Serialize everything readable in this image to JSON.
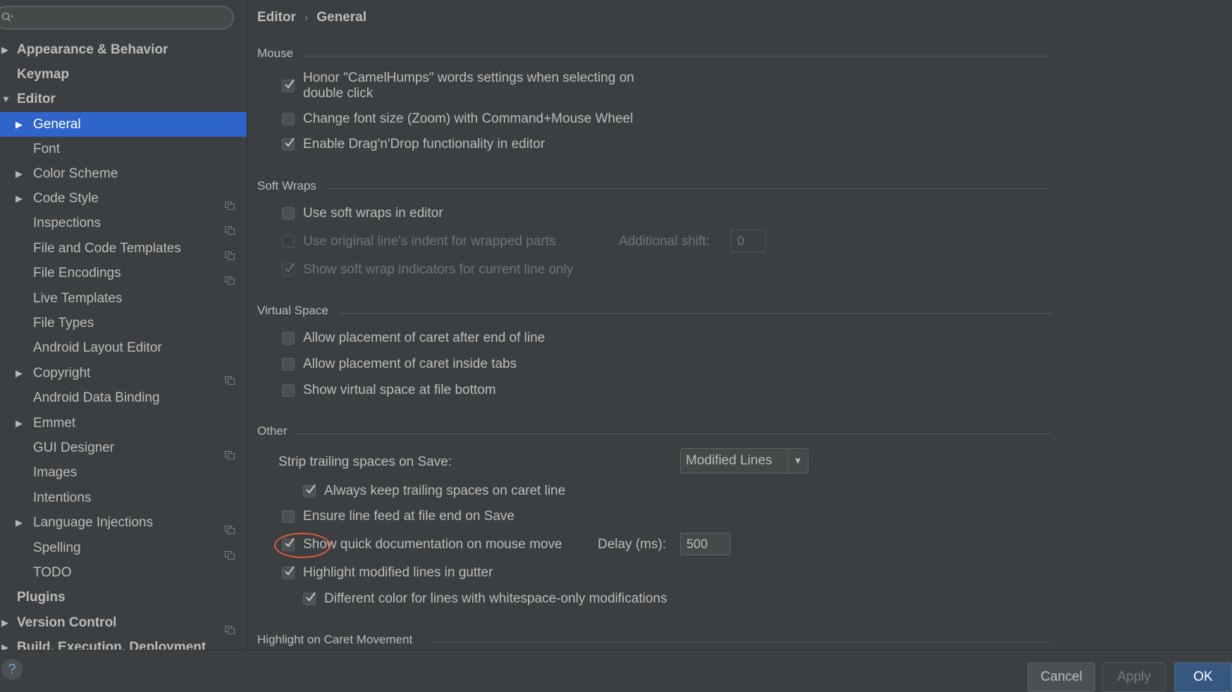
{
  "search": {
    "placeholder": ""
  },
  "sidebar": {
    "items": [
      {
        "label": "Appearance & Behavior"
      },
      {
        "label": "Keymap"
      },
      {
        "label": "Editor"
      },
      {
        "label": "General"
      },
      {
        "label": "Font"
      },
      {
        "label": "Color Scheme"
      },
      {
        "label": "Code Style"
      },
      {
        "label": "Inspections"
      },
      {
        "label": "File and Code Templates"
      },
      {
        "label": "File Encodings"
      },
      {
        "label": "Live Templates"
      },
      {
        "label": "File Types"
      },
      {
        "label": "Android Layout Editor"
      },
      {
        "label": "Copyright"
      },
      {
        "label": "Android Data Binding"
      },
      {
        "label": "Emmet"
      },
      {
        "label": "GUI Designer"
      },
      {
        "label": "Images"
      },
      {
        "label": "Intentions"
      },
      {
        "label": "Language Injections"
      },
      {
        "label": "Spelling"
      },
      {
        "label": "TODO"
      },
      {
        "label": "Plugins"
      },
      {
        "label": "Version Control"
      },
      {
        "label": "Build, Execution, Deployment"
      }
    ]
  },
  "breadcrumb": {
    "parent": "Editor",
    "separator": "›",
    "current": "General"
  },
  "sections": {
    "mouse": {
      "title": "Mouse",
      "camelhumps_line1": "Honor \"CamelHumps\" words settings when selecting on",
      "camelhumps_line2": "double click",
      "zoom": "Change font size (Zoom) with Command+Mouse Wheel",
      "dragdrop": "Enable Drag'n'Drop functionality in editor"
    },
    "soft_wraps": {
      "title": "Soft Wraps",
      "use_soft_wraps": "Use soft wraps in editor",
      "original_indent": "Use original line's indent for wrapped parts",
      "additional_shift_label": "Additional shift:",
      "additional_shift_value": "0",
      "indicators": "Show soft wrap indicators for current line only"
    },
    "virtual_space": {
      "title": "Virtual Space",
      "after_eol": "Allow placement of caret after end of line",
      "inside_tabs": "Allow placement of caret inside tabs",
      "file_bottom": "Show virtual space at file bottom"
    },
    "other": {
      "title": "Other",
      "strip_label": "Strip trailing spaces on Save:",
      "strip_value": "Modified Lines",
      "keep_trailing": "Always keep trailing spaces on caret line",
      "line_feed": "Ensure line feed at file end on Save",
      "quick_doc": "Show quick documentation on mouse move",
      "delay_label": "Delay (ms):",
      "delay_value": "500",
      "highlight_modified": "Highlight modified lines in gutter",
      "whitespace_color": "Different color for lines with whitespace-only modifications"
    },
    "caret_movement": {
      "title": "Highlight on Caret Movement"
    }
  },
  "buttons": {
    "help": "?",
    "cancel": "Cancel",
    "apply": "Apply",
    "ok": "OK"
  },
  "colors": {
    "background": "#3c3f41",
    "selection": "#2f65ca",
    "highlight_ring": "#e35a3b",
    "primary_button": "#365880"
  }
}
